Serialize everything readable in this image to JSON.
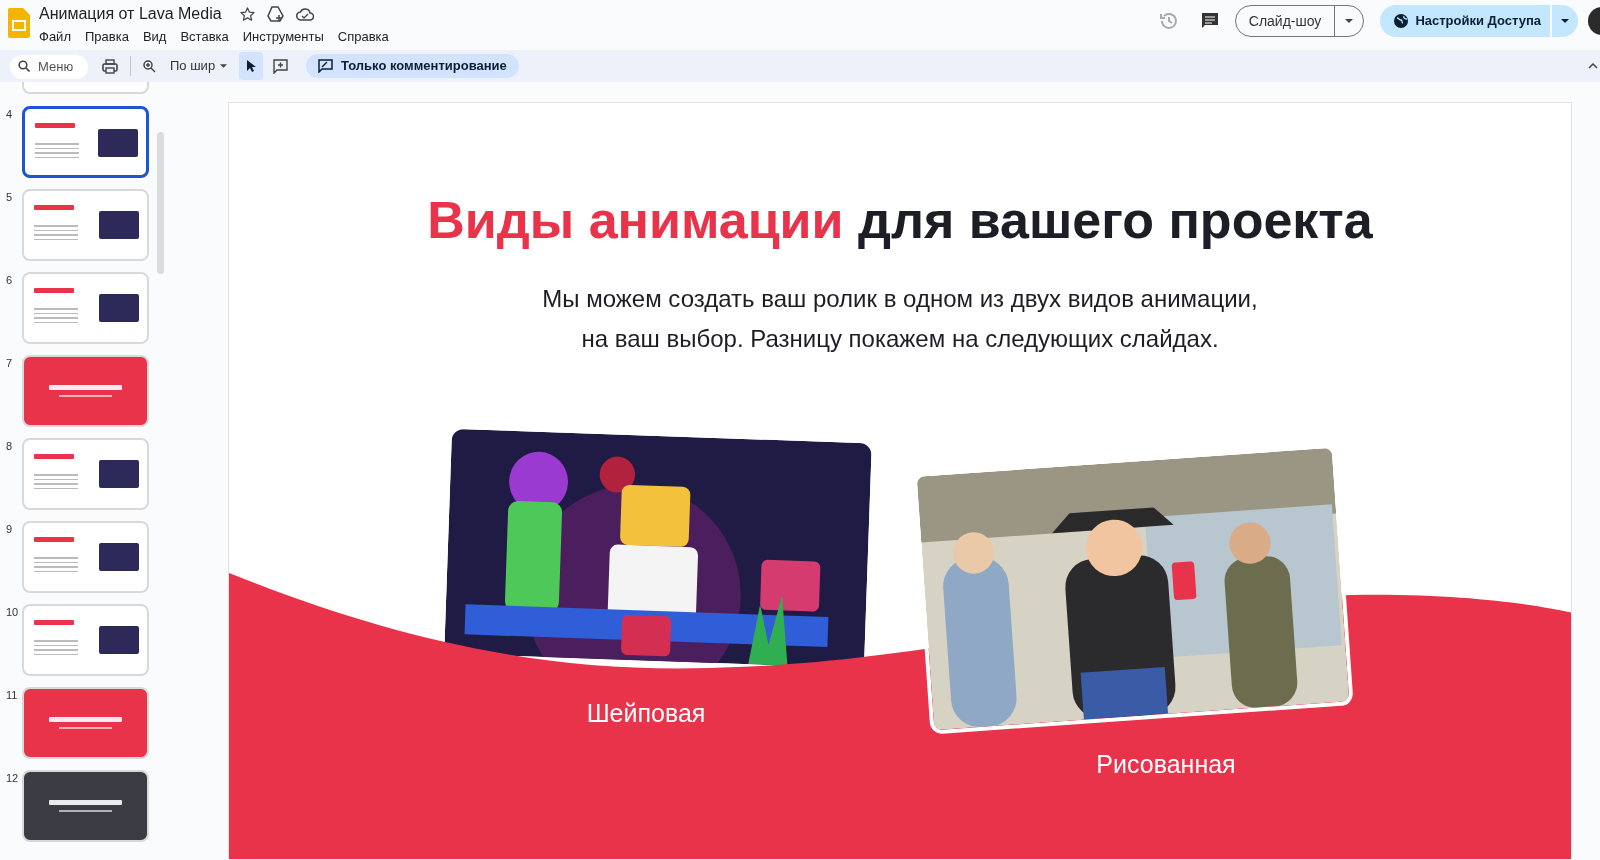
{
  "document": {
    "title": "Анимация от Lava Media"
  },
  "menu": [
    "Файл",
    "Правка",
    "Вид",
    "Вставка",
    "Инструменты",
    "Справка"
  ],
  "header_buttons": {
    "slideshow": "Слайд-шоу",
    "share": "Настройки Доступа"
  },
  "toolbar": {
    "search_placeholder": "Меню",
    "zoom": "По шир",
    "mode": "Только комментирование"
  },
  "thumbnails": [
    {
      "number": "4",
      "selected": true,
      "kind": "white"
    },
    {
      "number": "5",
      "selected": false,
      "kind": "white"
    },
    {
      "number": "6",
      "selected": false,
      "kind": "white"
    },
    {
      "number": "7",
      "selected": false,
      "kind": "red"
    },
    {
      "number": "8",
      "selected": false,
      "kind": "white"
    },
    {
      "number": "9",
      "selected": false,
      "kind": "white"
    },
    {
      "number": "10",
      "selected": false,
      "kind": "white"
    },
    {
      "number": "11",
      "selected": false,
      "kind": "red"
    },
    {
      "number": "12",
      "selected": false,
      "kind": "dark"
    }
  ],
  "slide": {
    "title_accent": "Виды анимации",
    "title": "для вашего проекта",
    "subtitle": [
      "Мы можем создать ваш ролик в одном из двух видов анимации,",
      "на ваш выбор. Разницу покажем на следующих слайдах."
    ],
    "cards": [
      {
        "kind": "picture",
        "label": "Шейповая"
      },
      {
        "kind": "picture",
        "label": "Рисованная"
      }
    ]
  }
}
